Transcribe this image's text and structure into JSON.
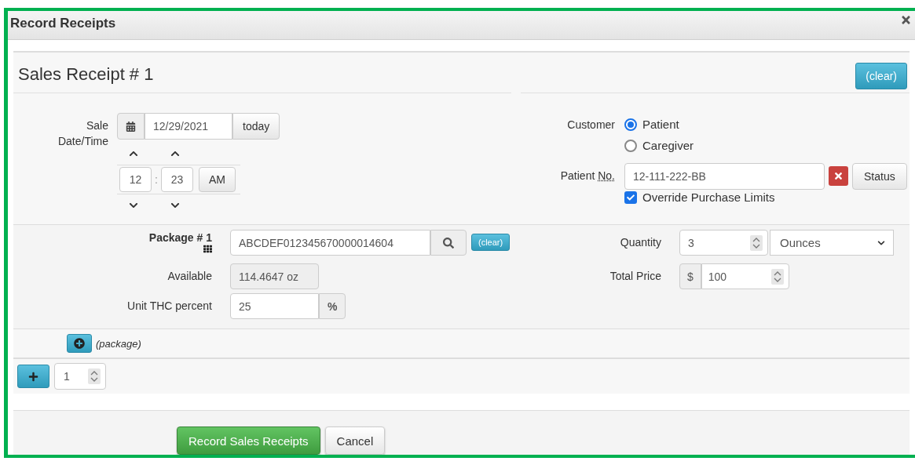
{
  "dialog": {
    "title": "Record Receipts"
  },
  "receipt": {
    "heading": "Sales Receipt # 1",
    "clear_button": "(clear)",
    "sale_date": {
      "label_lines": [
        "Sale",
        "Date/Time"
      ],
      "date": "12/29/2021",
      "today_button": "today",
      "hour": "12",
      "separator": ":",
      "minute": "23",
      "meridiem": "AM"
    },
    "customer": {
      "label": "Customer",
      "options": [
        {
          "label": "Patient",
          "selected": true
        },
        {
          "label": "Caregiver",
          "selected": false
        }
      ]
    },
    "patient_no": {
      "label": "Patient",
      "abbr": "No.",
      "value": "12-111-222-BB",
      "status_button": "Status"
    },
    "override": {
      "label": "Override Purchase Limits",
      "checked": true
    }
  },
  "package": {
    "label": "Package # 1",
    "tag": "ABCDEF012345670000014604",
    "clear_button": "(clear)",
    "available_label": "Available",
    "available": "114.4647 oz",
    "thc_label": "Unit THC percent",
    "thc": "25",
    "thc_unit": "%",
    "quantity_label": "Quantity",
    "quantity": "3",
    "unit": "Ounces",
    "price_label": "Total Price",
    "currency": "$",
    "price": "100"
  },
  "add_package": {
    "label": "(package)"
  },
  "add_receipts": {
    "count": "1"
  },
  "buttons": [
    {
      "label": "Record Sales Receipts",
      "kind": "primary"
    },
    {
      "label": "Cancel",
      "kind": "default"
    }
  ]
}
